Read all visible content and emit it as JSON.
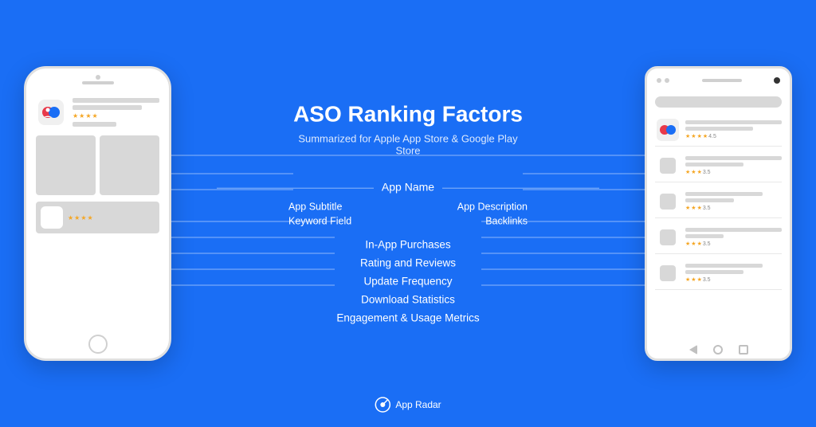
{
  "page": {
    "background_color": "#1a6ef5",
    "title": "ASO Ranking Factors",
    "subtitle": "Summarized for Apple App Store & Google Play Store"
  },
  "center": {
    "title": "ASO Ranking Factors",
    "subtitle": "Summarized for Apple App Store & Google Play Store",
    "factors": {
      "app_name": "App Name",
      "app_subtitle": "App Subtitle",
      "keyword_field": "Keyword Field",
      "app_description": "App Description",
      "backlinks": "Backlinks",
      "in_app_purchases": "In-App Purchases",
      "rating_and_reviews": "Rating and Reviews",
      "update_frequency": "Update Frequency",
      "download_statistics": "Download Statistics",
      "engagement_usage_metrics": "Engagement & Usage Metrics"
    }
  },
  "brand": {
    "name": "App Radar"
  },
  "phones": {
    "left": {
      "type": "iOS",
      "store": "Apple App Store"
    },
    "right": {
      "type": "Android",
      "store": "Google Play Store"
    }
  }
}
